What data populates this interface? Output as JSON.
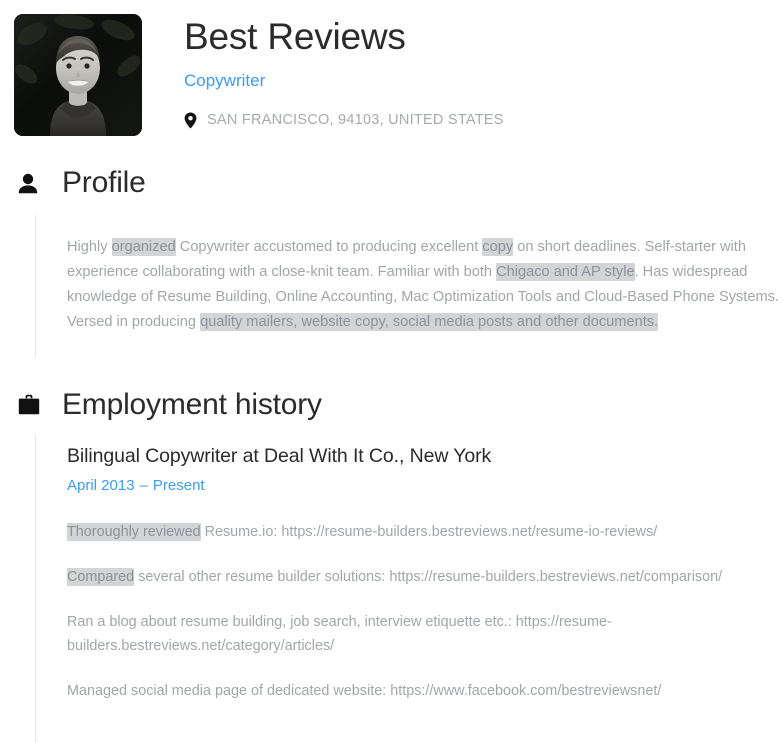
{
  "header": {
    "name": "Best Reviews",
    "job_title": "Copywriter",
    "location": "SAN FRANCISCO, 94103, UNITED STATES",
    "avatar_alt": "profile-photo"
  },
  "profile": {
    "heading": "Profile",
    "icon": "person-icon",
    "text_runs": [
      {
        "text": "Highly ",
        "highlight": false
      },
      {
        "text": "organized",
        "highlight": true
      },
      {
        "text": " Copywriter accustomed to producing excellent ",
        "highlight": false
      },
      {
        "text": "copy",
        "highlight": true
      },
      {
        "text": " on short deadlines. Self-starter with experience collaborating with a close-knit team. Familiar with both ",
        "highlight": false
      },
      {
        "text": "Chigaco and AP style",
        "highlight": true
      },
      {
        "text": ". Has widespread knowledge of Resume Building, Online Accounting, Mac Optimization Tools and Cloud-Based Phone Systems. Versed in producing ",
        "highlight": false
      },
      {
        "text": "quality mailers, website copy, social media posts and other documents.",
        "highlight": true
      }
    ]
  },
  "employment": {
    "heading": "Employment history",
    "icon": "briefcase-icon",
    "jobs": [
      {
        "title": "Bilingual Copywriter at Deal With It Co., New York",
        "date_start": "April 2013",
        "date_separator": "–",
        "date_end": "Present",
        "bullets": [
          [
            {
              "text": "Thoroughly reviewed",
              "highlight": true
            },
            {
              "text": " Resume.io: https://resume-builders.bestreviews.net/resume-io-reviews/",
              "highlight": false
            }
          ],
          [
            {
              "text": "Compared",
              "highlight": true
            },
            {
              "text": " several other resume builder solutions: https://resume-builders.bestreviews.net/comparison/",
              "highlight": false
            }
          ],
          [
            {
              "text": "Ran a blog about resume building, job search, interview etiquette etc.: https://resume-builders.bestreviews.net/category/articles/",
              "highlight": false
            }
          ],
          [
            {
              "text": "Managed social media page of dedicated website: https://www.facebook.com/bestreviewsnet/",
              "highlight": false
            }
          ]
        ]
      }
    ]
  },
  "colors": {
    "accent_blue": "#3b9cf5",
    "body_gray": "#a2a5ab",
    "heading_dark": "#2b2b2b",
    "highlight_gray": "#d3d4d6",
    "rule_gray": "#e3e5e8"
  }
}
